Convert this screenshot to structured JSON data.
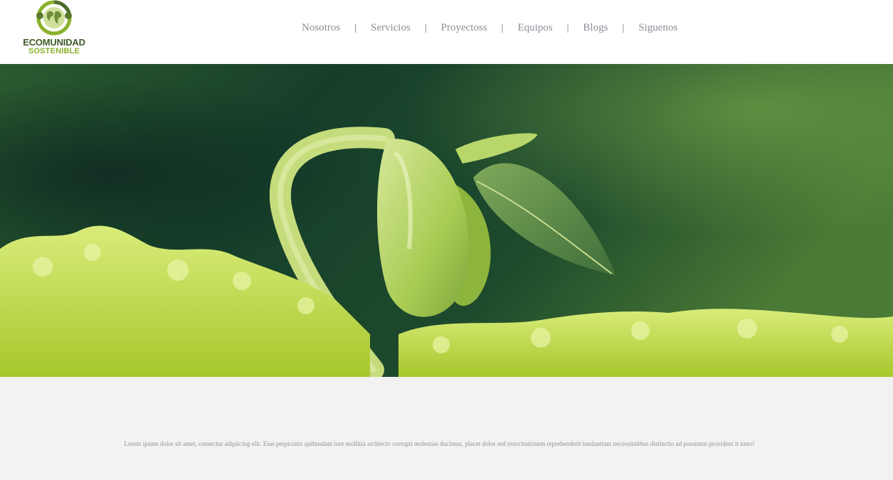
{
  "logo": {
    "line1": "ECOMUNIDAD",
    "line2": "SOSTENIBLE",
    "icon": "globe-leaf-emblem",
    "colors": {
      "dark": "#3f5a26",
      "light": "#8ab22b"
    }
  },
  "nav": {
    "items": [
      {
        "label": "Nosotros"
      },
      {
        "label": "Servicios"
      },
      {
        "label": "Proyectoss"
      },
      {
        "label": "Equipos"
      },
      {
        "label": "Blogs"
      },
      {
        "label": "Siguenos"
      }
    ],
    "separator": "|"
  },
  "hero": {
    "image": "seedling-sprout-on-moss",
    "colors": {
      "background": "#1f4a2a",
      "sprout": "#b9d36a",
      "moss": "#b5d332"
    }
  },
  "main": {
    "paragraph": "Lorem ipsum dolor sit amet, consectur adipiicing elit. Eius perpiciatis quibusdam iure mollitia archiecto corrupti molestias ducimus, placer dolor sed exercitationem reprehenderit laudantium necessitatibus distinctio ad possimus provident it iusto!"
  }
}
